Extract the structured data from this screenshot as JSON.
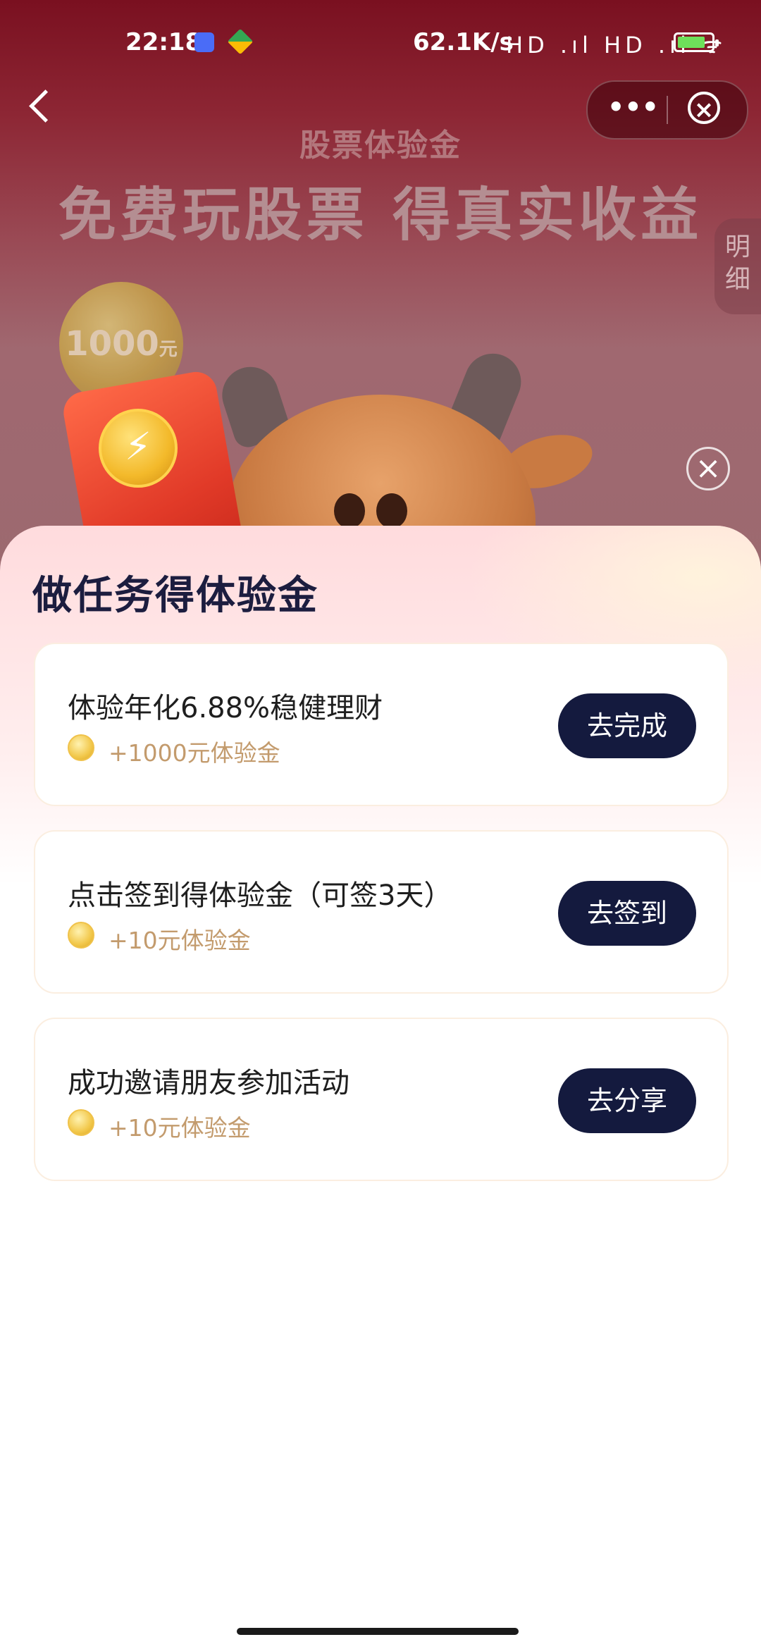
{
  "status_bar": {
    "time": "22:18",
    "network_speed": "62.1K/s",
    "signal_icons": "HD .ıl HD .ıl ᯤ"
  },
  "header": {
    "more_label": "•••",
    "close_label": "×"
  },
  "banner": {
    "subtitle": "股票体验金",
    "title": "免费玩股票 得真实收益",
    "detail_tab": "明\n细",
    "coin_amount": "1000",
    "coin_unit": "元"
  },
  "popup_close_label": "×",
  "tasks_section": {
    "title": "做任务得体验金",
    "tasks": [
      {
        "title": "体验年化6.88%稳健理财",
        "reward": "+1000元体验金",
        "button": "去完成"
      },
      {
        "title": "点击签到得体验金（可签3天）",
        "reward": "+10元体验金",
        "button": "去签到"
      },
      {
        "title": "成功邀请朋友参加活动",
        "reward": "+10元体验金",
        "button": "去分享"
      }
    ]
  },
  "colors": {
    "banner_top": "#7a1020",
    "button_bg": "#141a3e",
    "reward_text": "#c39b6d",
    "title_text": "#1c1d3f"
  }
}
